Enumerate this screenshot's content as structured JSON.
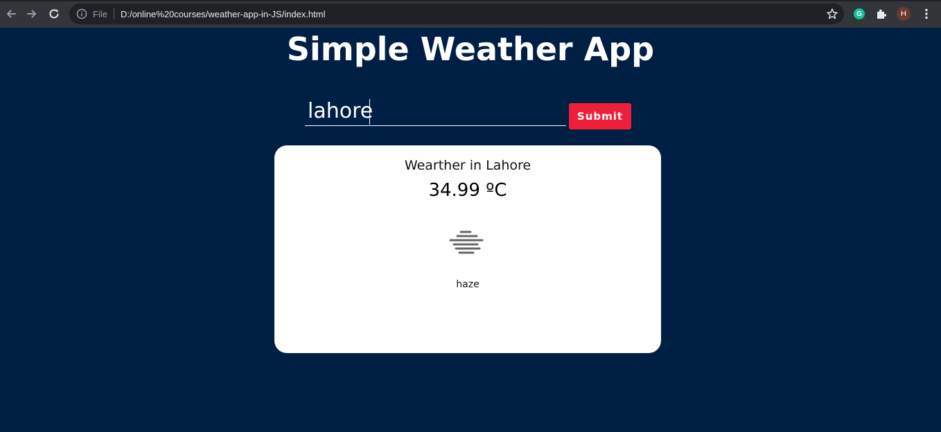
{
  "browser": {
    "omnibox_scheme_label": "File",
    "url": "D:/online%20courses/weather-app-in-JS/index.html",
    "avatar_initial": "H",
    "grammarly_letter": "G",
    "icons": [
      "back-arrow-icon",
      "forward-arrow-icon",
      "reload-icon",
      "info-icon",
      "star-icon",
      "grammarly-icon",
      "puzzle-icon",
      "kebab-menu-icon"
    ]
  },
  "page": {
    "title": "Simple Weather App",
    "search": {
      "value": "lahore",
      "placeholder": ""
    },
    "submit_label": "Submit",
    "card": {
      "heading": "Wearther in Lahore",
      "temperature": "34.99 ºC",
      "description": "haze",
      "icon": "haze-icon"
    }
  },
  "colors": {
    "background": "#001f44",
    "submit": "#ef1f3a",
    "card": "#ffffff"
  }
}
